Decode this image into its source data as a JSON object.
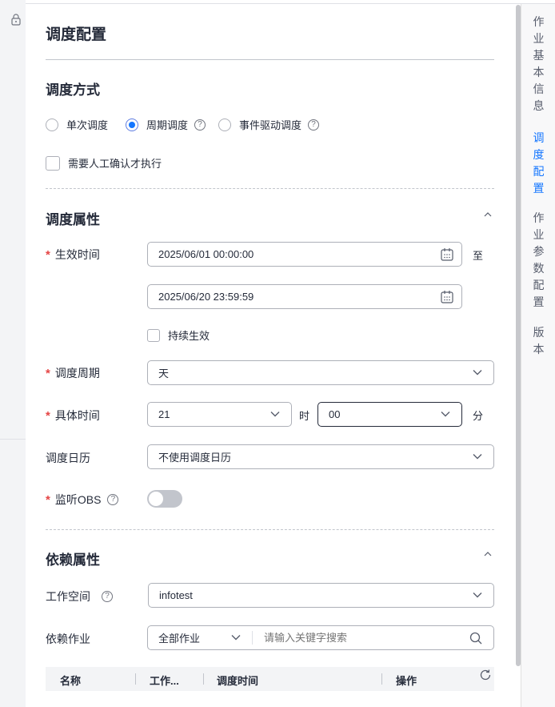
{
  "panel_title": "调度配置",
  "schedule_mode": {
    "heading": "调度方式",
    "options": [
      {
        "label": "单次调度",
        "checked": false,
        "help": false
      },
      {
        "label": "周期调度",
        "checked": true,
        "help": true
      },
      {
        "label": "事件驱动调度",
        "checked": false,
        "help": true
      }
    ],
    "manual_confirm_label": "需要人工确认才执行"
  },
  "schedule_props": {
    "heading": "调度属性",
    "effective_time_label": "生效时间",
    "start_time": "2025/06/01 00:00:00",
    "to_label": "至",
    "end_time": "2025/06/20 23:59:59",
    "permanent_label": "持续生效",
    "cycle_label": "调度周期",
    "cycle_value": "天",
    "specific_time_label": "具体时间",
    "hour_value": "21",
    "hour_unit": "时",
    "minute_value": "00",
    "minute_unit": "分",
    "calendar_label": "调度日历",
    "calendar_value": "不使用调度日历",
    "listen_obs_label": "监听OBS",
    "listen_obs_on": false
  },
  "dependency_props": {
    "heading": "依赖属性",
    "workspace_label": "工作空间",
    "workspace_value": "infotest",
    "dep_job_label": "依赖作业",
    "dep_job_filter": "全部作业",
    "search_placeholder": "请输入关键字搜索",
    "table_headers": [
      "名称",
      "工作...",
      "调度时间",
      "操作"
    ]
  },
  "right_nav": [
    {
      "label": "作业基本信息",
      "active": false
    },
    {
      "label": "调度配置",
      "active": true
    },
    {
      "label": "作业参数配置",
      "active": false
    },
    {
      "label": "版本",
      "active": false
    }
  ],
  "colors": {
    "accent": "#1476ff",
    "required": "#e54545"
  }
}
